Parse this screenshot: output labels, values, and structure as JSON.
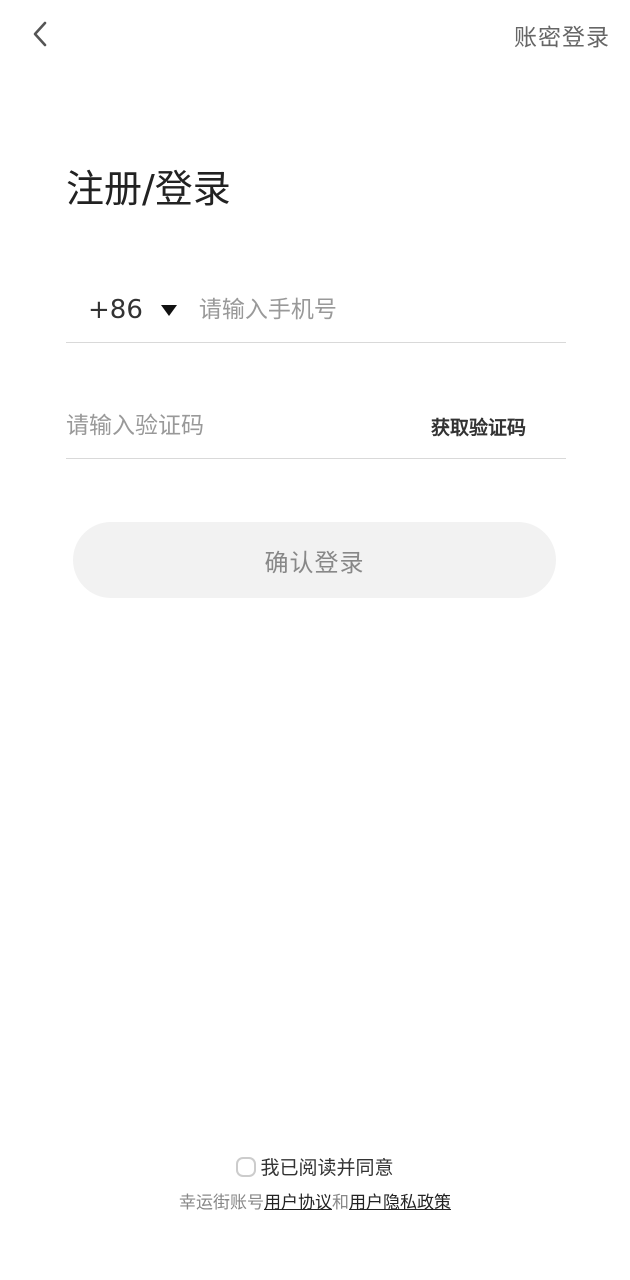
{
  "header": {
    "back_icon": "chevron-left-icon",
    "alt_login_label": "账密登录"
  },
  "title": "注册/登录",
  "phone": {
    "country_code": "+86",
    "caret_icon": "triangle-down-icon",
    "placeholder": "请输入手机号",
    "value": ""
  },
  "code": {
    "placeholder": "请输入验证码",
    "value": "",
    "get_code_label": "获取验证码"
  },
  "confirm_label": "确认登录",
  "agreement": {
    "checked": false,
    "text": "我已阅读并同意",
    "prefix": "幸运街账号",
    "user_agreement": "用户协议",
    "conjunction": "和",
    "privacy_policy": "用户隐私政策"
  }
}
